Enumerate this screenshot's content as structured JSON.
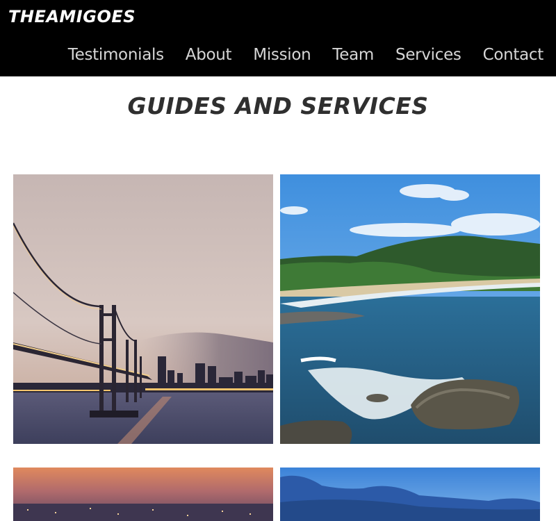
{
  "brand": {
    "name": "TheAmigoes"
  },
  "nav": {
    "items": [
      {
        "label": "Testimonials"
      },
      {
        "label": "About"
      },
      {
        "label": "Mission"
      },
      {
        "label": "Team"
      },
      {
        "label": "Services"
      },
      {
        "label": "Contact"
      }
    ]
  },
  "main": {
    "title": "Guides and Services",
    "gallery": [
      {
        "image": "bridge-city-dusk-photo"
      },
      {
        "image": "coastline-beach-rocks-photo"
      },
      {
        "image": "city-lights-sunset-photo"
      },
      {
        "image": "blue-mountains-sky-photo"
      }
    ]
  },
  "colors": {
    "header_bg": "#000000",
    "nav_text": "#d6d6d6",
    "title_text": "#2f2f2f",
    "page_bg": "#ffffff"
  }
}
